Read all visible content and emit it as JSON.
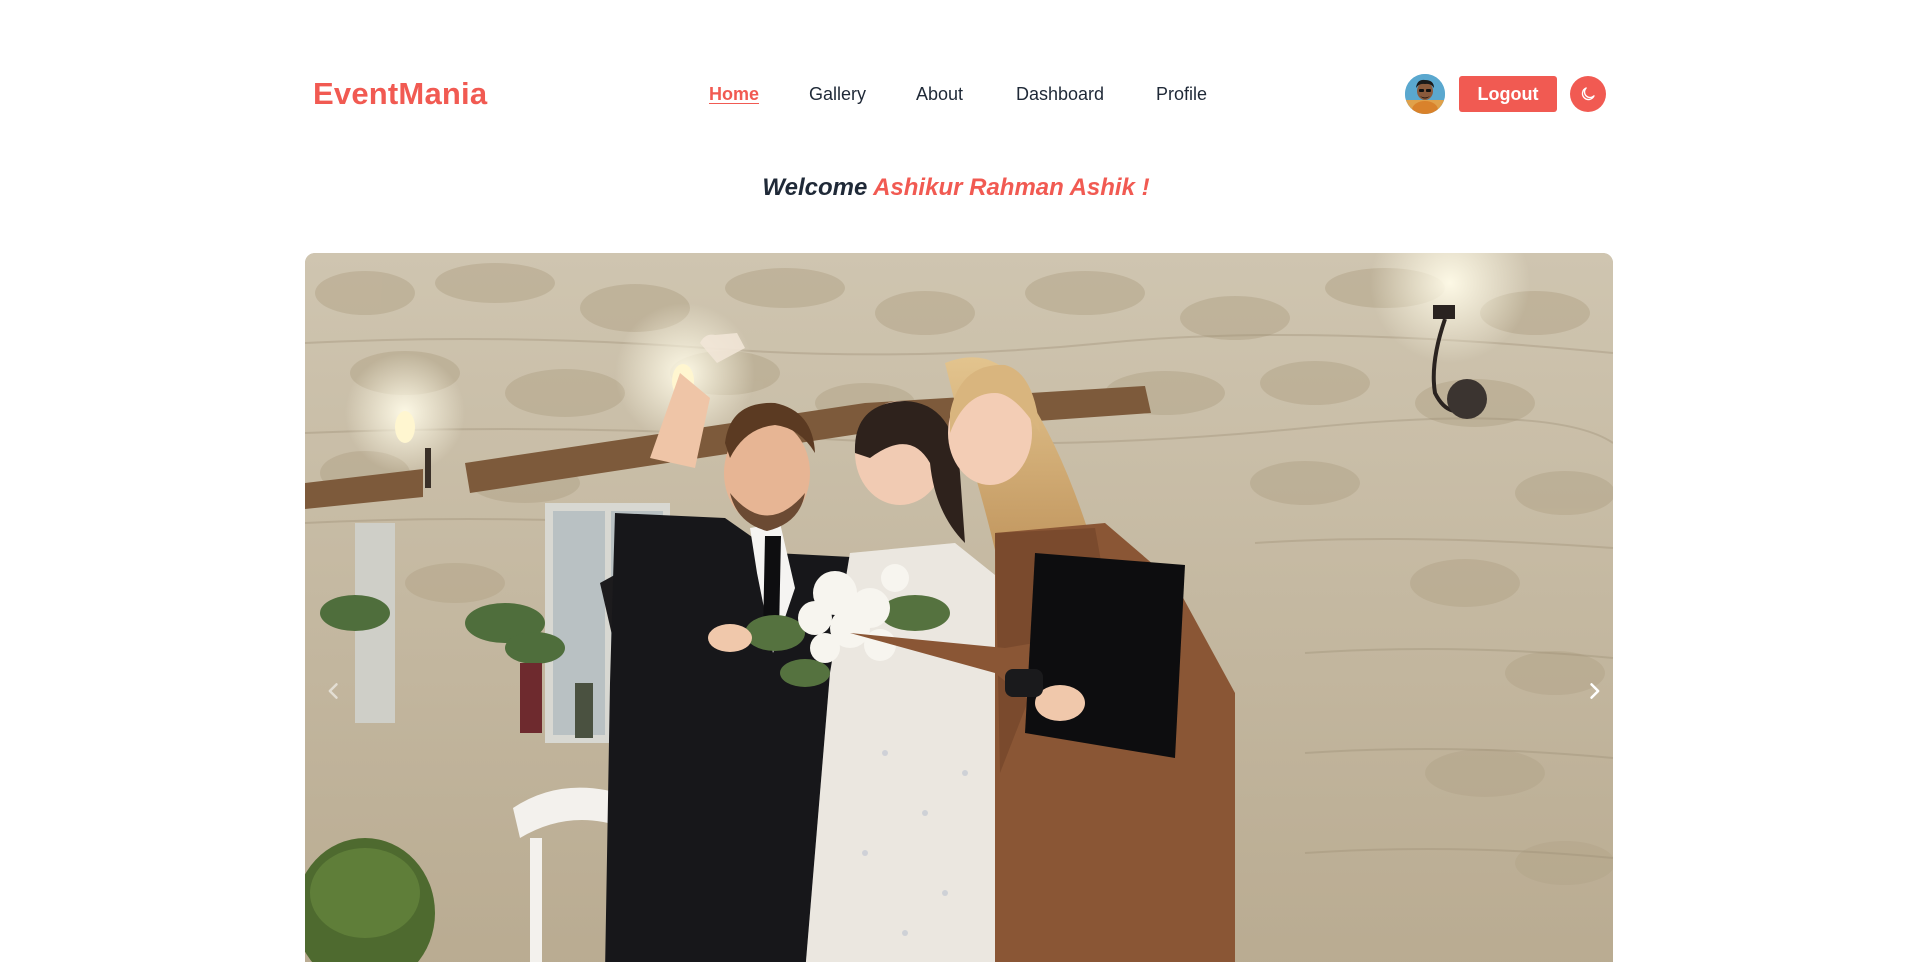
{
  "brand": {
    "name": "EventMania"
  },
  "nav": {
    "items": [
      {
        "label": "Home",
        "active": true
      },
      {
        "label": "Gallery",
        "active": false
      },
      {
        "label": "About",
        "active": false
      },
      {
        "label": "Dashboard",
        "active": false
      },
      {
        "label": "Profile",
        "active": false
      }
    ]
  },
  "user": {
    "avatar_icon": "user-avatar",
    "logout_label": "Logout",
    "theme_icon": "moon-icon"
  },
  "welcome": {
    "prefix": "Welcome",
    "name": "Ashikur Rahman Ashik !"
  },
  "carousel": {
    "prev_icon": "chevron-left-icon",
    "next_icon": "chevron-right-icon",
    "image_subject": "wedding-event-photo"
  },
  "colors": {
    "accent": "#f15a52",
    "text": "#1f2937",
    "background": "#ffffff"
  }
}
